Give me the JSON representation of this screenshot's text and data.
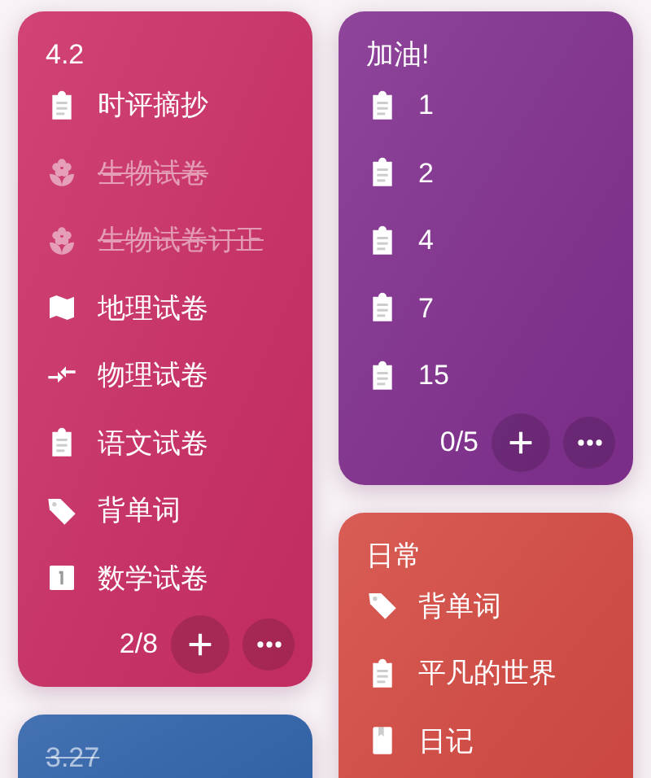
{
  "columns": [
    {
      "cards": [
        {
          "title": "4.2",
          "done": false,
          "color": "#cc2f66",
          "items": [
            {
              "kind": "clipboard",
              "text": "时评摘抄",
              "done": false
            },
            {
              "kind": "flower",
              "text": "生物试卷",
              "done": true
            },
            {
              "kind": "flower",
              "text": "生物试卷订正",
              "done": true
            },
            {
              "kind": "map",
              "text": "地理试卷",
              "done": false
            },
            {
              "kind": "compress",
              "text": "物理试卷",
              "done": false
            },
            {
              "kind": "clipboard",
              "text": "语文试卷",
              "done": false
            },
            {
              "kind": "tag",
              "text": "背单词",
              "done": false
            },
            {
              "kind": "one",
              "text": "数学试卷",
              "done": false
            }
          ],
          "count": "2/8"
        },
        {
          "title": "3.27",
          "done": true,
          "color": "#2f62aa"
        }
      ]
    },
    {
      "cards": [
        {
          "title": "加油!",
          "done": false,
          "color": "#82308f",
          "items": [
            {
              "kind": "clipboard",
              "text": "1",
              "done": false
            },
            {
              "kind": "clipboard",
              "text": "2",
              "done": false
            },
            {
              "kind": "clipboard",
              "text": "4",
              "done": false
            },
            {
              "kind": "clipboard",
              "text": "7",
              "done": false
            },
            {
              "kind": "clipboard",
              "text": "15",
              "done": false
            }
          ],
          "count": "0/5"
        },
        {
          "title": "日常",
          "done": false,
          "color": "#d44a42",
          "items": [
            {
              "kind": "tag",
              "text": "背单词",
              "done": false
            },
            {
              "kind": "clipboard",
              "text": "平凡的世界",
              "done": false
            },
            {
              "kind": "book",
              "text": "日记",
              "done": false
            }
          ]
        }
      ]
    }
  ]
}
